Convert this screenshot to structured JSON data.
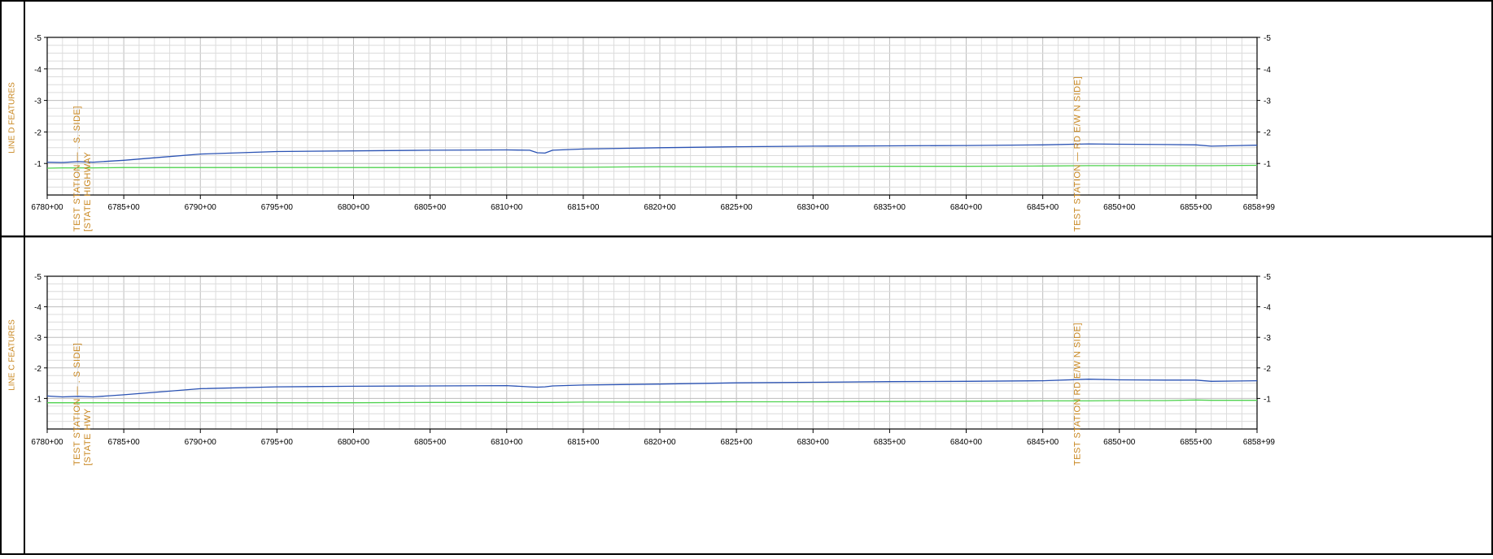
{
  "colors": {
    "frame": "#000000",
    "grid_major": "#bdbdbd",
    "grid_minor": "#dcdcdc",
    "annotation": "#c8861e",
    "side_label": "#c8861e",
    "series_blue": "#2a52b3",
    "series_green": "#4fd24f",
    "background": "#ffffff"
  },
  "panels": [
    {
      "side_label": "LINE D FEATURES",
      "y_ticks": [
        "-5",
        "-4",
        "-3",
        "-2",
        "-1"
      ],
      "x_ticks": [
        "6780+00",
        "6785+00",
        "6790+00",
        "6795+00",
        "6800+00",
        "6805+00",
        "6810+00",
        "6815+00",
        "6820+00",
        "6825+00",
        "6830+00",
        "6835+00",
        "6840+00",
        "6845+00",
        "6850+00",
        "6855+00",
        "6858+99"
      ],
      "annotations": [
        {
          "lines": [
            "TEST STATION  —   .   S. SIDE]",
            "[STATE HIGHWAY"
          ],
          "x": 6781.5
        },
        {
          "lines": [
            "TEST STATION  —  RD E/W N SIDE]"
          ],
          "x": 6846.8
        }
      ]
    },
    {
      "side_label": "LINE C FEATURES",
      "y_ticks": [
        "-5",
        "-4",
        "-3",
        "-2",
        "-1"
      ],
      "x_ticks": [
        "6780+00",
        "6785+00",
        "6790+00",
        "6795+00",
        "6800+00",
        "6805+00",
        "6810+00",
        "6815+00",
        "6820+00",
        "6825+00",
        "6830+00",
        "6835+00",
        "6840+00",
        "6845+00",
        "6850+00",
        "6855+00",
        "6858+99"
      ],
      "annotations": [
        {
          "lines": [
            "TEST STATION  —   .   S SIDE]",
            "[STATE HWY"
          ],
          "x": 6781.5
        },
        {
          "lines": [
            "TEST STATION   RD E/W N SIDE]"
          ],
          "x": 6846.8
        }
      ]
    }
  ],
  "chart_data": [
    {
      "type": "line",
      "title": "",
      "ylabel": "",
      "xlabel": "",
      "xlim": [
        6780,
        6858.99
      ],
      "ylim": [
        -5,
        0
      ],
      "y_axis_inverted": true,
      "grid": true,
      "x": [
        6779.6,
        6781,
        6782,
        6783,
        6785,
        6787,
        6790,
        6795,
        6800,
        6805,
        6810,
        6811.5,
        6812,
        6812.5,
        6813,
        6815,
        6820,
        6825,
        6830,
        6835,
        6840,
        6845,
        6848,
        6850,
        6853,
        6855,
        6856,
        6858.99
      ],
      "series": [
        {
          "name": "",
          "color": "#2a52b3",
          "values": [
            -1.04,
            -1.03,
            -1.06,
            -1.04,
            -1.1,
            -1.18,
            -1.3,
            -1.38,
            -1.4,
            -1.42,
            -1.43,
            -1.42,
            -1.34,
            -1.33,
            -1.42,
            -1.46,
            -1.5,
            -1.53,
            -1.55,
            -1.56,
            -1.57,
            -1.59,
            -1.62,
            -1.61,
            -1.6,
            -1.59,
            -1.55,
            -1.58
          ]
        },
        {
          "name": "",
          "color": "#4fd24f",
          "values": [
            -0.85,
            -0.86,
            -0.86,
            -0.86,
            -0.87,
            -0.87,
            -0.87,
            -0.87,
            -0.87,
            -0.87,
            -0.88,
            -0.88,
            -0.88,
            -0.88,
            -0.88,
            -0.88,
            -0.9,
            -0.9,
            -0.9,
            -0.91,
            -0.91,
            -0.92,
            -0.93,
            -0.93,
            -0.93,
            -0.93,
            -0.93,
            -0.94
          ]
        }
      ]
    },
    {
      "type": "line",
      "title": "",
      "ylabel": "",
      "xlabel": "",
      "xlim": [
        6780,
        6858.99
      ],
      "ylim": [
        -5,
        0
      ],
      "y_axis_inverted": true,
      "grid": true,
      "x": [
        6779.6,
        6781,
        6782,
        6783,
        6785,
        6787,
        6790,
        6795,
        6800,
        6805,
        6810,
        6811.5,
        6812,
        6812.5,
        6813,
        6815,
        6820,
        6825,
        6830,
        6835,
        6840,
        6845,
        6848,
        6850,
        6853,
        6855,
        6856,
        6858.99
      ],
      "series": [
        {
          "name": "",
          "color": "#2a52b3",
          "values": [
            -1.08,
            -1.05,
            -1.07,
            -1.05,
            -1.12,
            -1.2,
            -1.32,
            -1.38,
            -1.4,
            -1.41,
            -1.42,
            -1.38,
            -1.37,
            -1.38,
            -1.41,
            -1.44,
            -1.47,
            -1.51,
            -1.53,
            -1.55,
            -1.56,
            -1.58,
            -1.63,
            -1.61,
            -1.6,
            -1.6,
            -1.56,
            -1.58
          ]
        },
        {
          "name": "",
          "color": "#4fd24f",
          "values": [
            -0.86,
            -0.86,
            -0.86,
            -0.86,
            -0.86,
            -0.86,
            -0.86,
            -0.86,
            -0.86,
            -0.87,
            -0.87,
            -0.87,
            -0.87,
            -0.87,
            -0.87,
            -0.88,
            -0.88,
            -0.89,
            -0.89,
            -0.9,
            -0.91,
            -0.92,
            -0.92,
            -0.93,
            -0.93,
            -0.95,
            -0.94,
            -0.94
          ]
        }
      ]
    }
  ]
}
